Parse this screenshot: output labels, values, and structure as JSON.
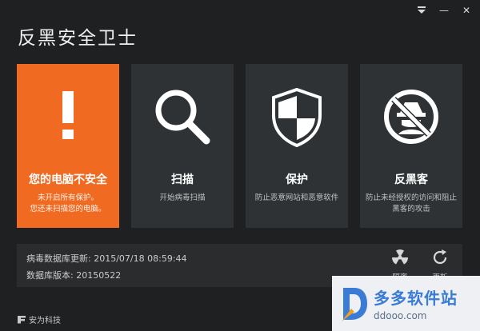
{
  "window": {
    "title": "反黑安全卫士",
    "controls": {
      "menu_icon": "menu-down-icon",
      "minimize": "—",
      "close": "✕"
    }
  },
  "tiles": [
    {
      "name": "status",
      "title": "您的电脑不安全",
      "desc_lines": [
        "未开启所有保护。",
        "您还未扫描您的电脑。"
      ],
      "icon": "exclamation-icon",
      "color": "#f06a22"
    },
    {
      "name": "scan",
      "title": "扫描",
      "desc_lines": [
        "开始病毒扫描"
      ],
      "icon": "magnifier-icon"
    },
    {
      "name": "protect",
      "title": "保护",
      "desc_lines": [
        "防止恶意网站和恶意软件"
      ],
      "icon": "shield-icon"
    },
    {
      "name": "antihacker",
      "title": "反黑客",
      "desc_lines": [
        "防止未经授权的访问和阻止",
        "黑客的攻击"
      ],
      "icon": "no-hacker-icon"
    }
  ],
  "info": {
    "db_update_label": "病毒数据库更新:",
    "db_update_value": "2015/07/18 08:59:44",
    "db_version_label": "数据库版本:",
    "db_version_value": "20150522"
  },
  "tools": {
    "quarantine_label": "隔离",
    "update_label": "更新"
  },
  "footer": {
    "brand": "安为科技"
  },
  "watermark": {
    "name": "多多软件站",
    "url": "ddooo.com"
  },
  "colors": {
    "background": "#1f2022",
    "tile": "#2e3235",
    "alert": "#f06a22",
    "panel": "#2a2c2e"
  }
}
